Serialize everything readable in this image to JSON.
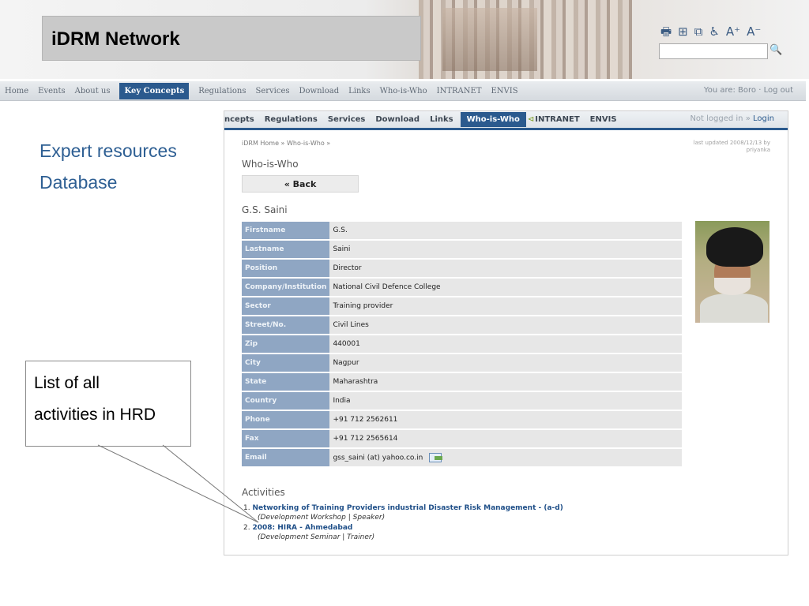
{
  "title": "iDRM Network",
  "toolbar": {
    "icons": [
      "print-icon",
      "sitemap-icon",
      "copy-icon",
      "accessibility-icon",
      "font-increase-icon",
      "font-decrease-icon"
    ],
    "glyphs": [
      "🖶",
      "⊞",
      "⧉",
      "♿",
      "A⁺",
      "A⁻"
    ]
  },
  "outer_nav": {
    "items": [
      "Home",
      "Events",
      "About us",
      "Key Concepts",
      "Regulations",
      "Services",
      "Download",
      "Links",
      "Who-is-Who",
      "INTRANET",
      "ENVIS"
    ],
    "active": "Key Concepts",
    "login_text": "You are: Boro · Log out"
  },
  "slide": {
    "bullets": [
      "Expert resources",
      "Database"
    ],
    "callout": [
      "List of all",
      "activities in HRD"
    ]
  },
  "inner_nav": {
    "items": [
      "ncepts",
      "Regulations",
      "Services",
      "Download",
      "Links",
      "Who-is-Who",
      "INTRANET",
      "ENVIS"
    ],
    "active": "Who-is-Who",
    "status": "Not logged in",
    "login": "Login"
  },
  "page": {
    "breadcrumb": "iDRM Home » Who-is-Who »",
    "updated": "last updated 2008/12/13 by priyanka",
    "heading": "Who-is-Who",
    "back_label": "« Back",
    "person": "G.S. Saini",
    "fields": [
      {
        "label": "Firstname",
        "value": "G.S."
      },
      {
        "label": "Lastname",
        "value": "Saini"
      },
      {
        "label": "Position",
        "value": "Director"
      },
      {
        "label": "Company/Institution",
        "value": "National Civil Defence College"
      },
      {
        "label": "Sector",
        "value": "Training provider"
      },
      {
        "label": "Street/No.",
        "value": "Civil Lines"
      },
      {
        "label": "Zip",
        "value": "440001"
      },
      {
        "label": "City",
        "value": "Nagpur"
      },
      {
        "label": "State",
        "value": "Maharashtra"
      },
      {
        "label": "Country",
        "value": "India"
      },
      {
        "label": "Phone",
        "value": "+91 712 2562611"
      },
      {
        "label": "Fax",
        "value": "+91 712 2565614"
      },
      {
        "label": "Email",
        "value": "gss_saini (at) yahoo.co.in"
      }
    ],
    "activities_heading": "Activities",
    "activities": [
      {
        "num": "1.",
        "title": "Networking of Training Providers industrial Disaster Risk Management - (a-d)",
        "sub": "(Development Workshop | Speaker)"
      },
      {
        "num": "2.",
        "title": "2008: HIRA - Ahmedabad",
        "sub": "(Development Seminar | Trainer)"
      }
    ]
  }
}
